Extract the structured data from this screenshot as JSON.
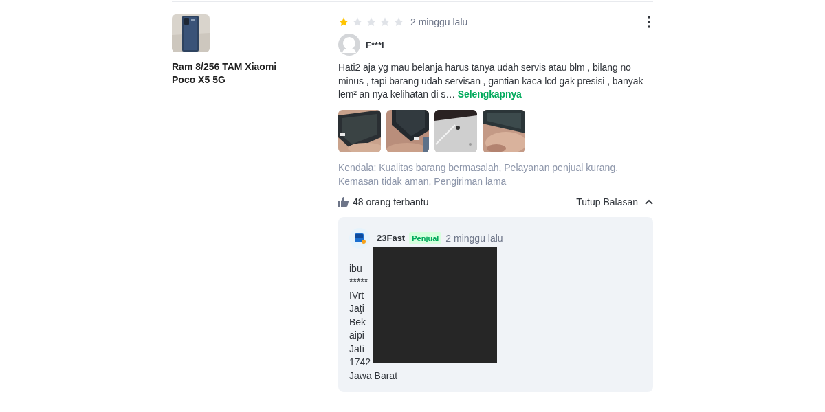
{
  "product": {
    "image": {
      "kind": "picture"
    },
    "name": "Ram 8/256 TAM Xiaomi Poco X5 5G"
  },
  "review": {
    "stars": 1,
    "time": "2 minggu lalu",
    "reviewer": "F***l",
    "text": "Hati2 aja yg mau belanja harus tanya udah servis atau blm , bilang no minus , tapi barang udah servisan , gantian kaca lcd gak presisi , banyak lem² an nya kelihatan di s…",
    "more_link": "Selengkapnya",
    "photos": [
      {
        "kind": "picture"
      },
      {
        "kind": "picture"
      },
      {
        "kind": "picture"
      },
      {
        "kind": "picture"
      }
    ],
    "issues": "Kendala: Kualitas barang bermasalah, Pelayanan penjual kurang, Kemasan tidak aman, Pengiriman lama",
    "helpful": "48 orang terbantu",
    "replies_toggle": {
      "label": "Tutup Balasan",
      "expanded": true
    }
  },
  "reply": {
    "seller": "23Fast",
    "badge": "Penjual",
    "time": "2 minggu lalu",
    "lines": [
      "ibu",
      "*****",
      "IVrt",
      "Jaţi",
      "Bek",
      "aipi",
      "Jati",
      "1742",
      "Jawa Barat"
    ]
  }
}
